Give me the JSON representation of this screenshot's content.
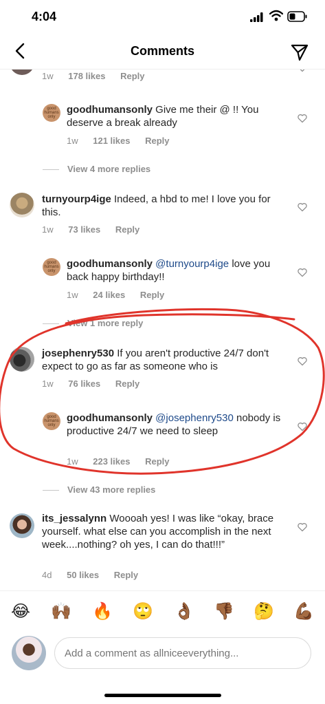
{
  "status": {
    "time": "4:04"
  },
  "header": {
    "title": "Comments"
  },
  "comments": [
    {
      "type": "partial",
      "meta": {
        "age": "1w",
        "likes": "178 likes",
        "reply": "Reply"
      }
    },
    {
      "type": "reply",
      "username": "goodhumansonly",
      "text": "Give me their @ !! You deserve a break already",
      "meta": {
        "age": "1w",
        "likes": "121 likes",
        "reply": "Reply"
      }
    },
    {
      "type": "viewmore",
      "label": "View 4 more replies"
    },
    {
      "type": "comment",
      "username": "turnyourp4ige",
      "text": "Indeed, a hbd to me! I love you for this.",
      "meta": {
        "age": "1w",
        "likes": "73 likes",
        "reply": "Reply"
      }
    },
    {
      "type": "reply",
      "username": "goodhumansonly",
      "mention": "@turnyourp4ige",
      "text": "love you back happy birthday!!",
      "meta": {
        "age": "1w",
        "likes": "24 likes",
        "reply": "Reply"
      }
    },
    {
      "type": "viewmore",
      "label": "View 1 more reply"
    },
    {
      "type": "comment",
      "username": "josephenry530",
      "text": "If you aren't productive 24/7 don't expect to go as far as someone who is",
      "meta": {
        "age": "1w",
        "likes": "76 likes",
        "reply": "Reply"
      }
    },
    {
      "type": "reply",
      "username": "goodhumansonly",
      "mention": "@josephenry530",
      "text": "nobody is productive 24/7 we need to sleep",
      "meta": {
        "age": "1w",
        "likes": "223 likes",
        "reply": "Reply"
      }
    },
    {
      "type": "viewmore",
      "label": "View 43 more replies"
    },
    {
      "type": "comment",
      "username": "its_jessalynn",
      "text": "Woooah yes! I was like “okay, brace yourself. what else can you accomplish in the next week....nothing? oh yes, I can do that!!!”",
      "meta": {
        "age": "4d",
        "likes": "50 likes",
        "reply": "Reply"
      }
    }
  ],
  "avatar_text": {
    "goodhumansonly": "good humans only"
  },
  "emoji_bar": [
    "😂",
    "🙌🏾",
    "🔥",
    "🙄",
    "👌🏾",
    "👎🏾",
    "🤔",
    "💪🏾"
  ],
  "composer": {
    "placeholder": "Add a comment as allniceeverything..."
  },
  "colors": {
    "accent": "#e0342b",
    "mention": "#1e4a8a",
    "muted": "#8e8e8e"
  }
}
